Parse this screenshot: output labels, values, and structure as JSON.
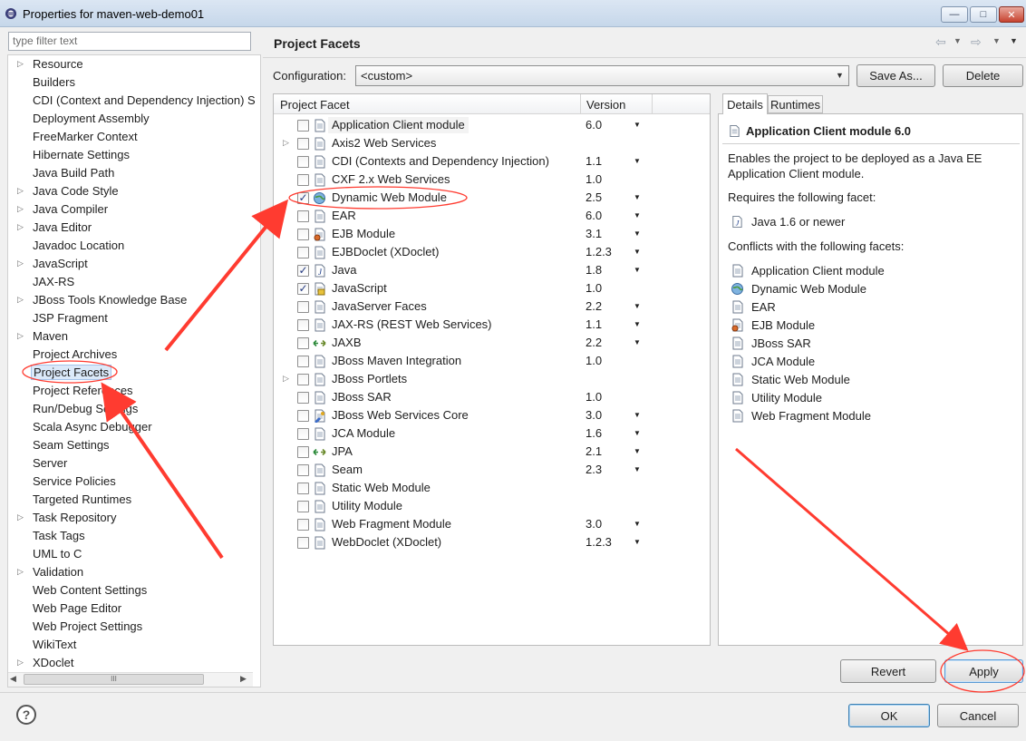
{
  "window": {
    "title": "Properties for maven-web-demo01",
    "minimize_glyph": "—",
    "maximize_glyph": "□",
    "close_glyph": "✕"
  },
  "filter": {
    "placeholder": "type filter text"
  },
  "tree": {
    "items": [
      {
        "label": "Resource",
        "expandable": true
      },
      {
        "label": "Builders",
        "expandable": false
      },
      {
        "label": "CDI (Context and Dependency Injection) S",
        "expandable": false
      },
      {
        "label": "Deployment Assembly",
        "expandable": false
      },
      {
        "label": "FreeMarker Context",
        "expandable": false
      },
      {
        "label": "Hibernate Settings",
        "expandable": false
      },
      {
        "label": "Java Build Path",
        "expandable": false
      },
      {
        "label": "Java Code Style",
        "expandable": true
      },
      {
        "label": "Java Compiler",
        "expandable": true
      },
      {
        "label": "Java Editor",
        "expandable": true
      },
      {
        "label": "Javadoc Location",
        "expandable": false
      },
      {
        "label": "JavaScript",
        "expandable": true
      },
      {
        "label": "JAX-RS",
        "expandable": false
      },
      {
        "label": "JBoss Tools Knowledge Base",
        "expandable": true
      },
      {
        "label": "JSP Fragment",
        "expandable": false
      },
      {
        "label": "Maven",
        "expandable": true
      },
      {
        "label": "Project Archives",
        "expandable": false
      },
      {
        "label": "Project Facets",
        "expandable": false,
        "selected": true
      },
      {
        "label": "Project References",
        "expandable": false
      },
      {
        "label": "Run/Debug Settings",
        "expandable": false
      },
      {
        "label": "Scala Async Debugger",
        "expandable": false
      },
      {
        "label": "Seam Settings",
        "expandable": false
      },
      {
        "label": "Server",
        "expandable": false
      },
      {
        "label": "Service Policies",
        "expandable": false
      },
      {
        "label": "Targeted Runtimes",
        "expandable": false
      },
      {
        "label": "Task Repository",
        "expandable": true
      },
      {
        "label": "Task Tags",
        "expandable": false
      },
      {
        "label": "UML to C",
        "expandable": false
      },
      {
        "label": "Validation",
        "expandable": true
      },
      {
        "label": "Web Content Settings",
        "expandable": false
      },
      {
        "label": "Web Page Editor",
        "expandable": false
      },
      {
        "label": "Web Project Settings",
        "expandable": false
      },
      {
        "label": "WikiText",
        "expandable": false
      },
      {
        "label": "XDoclet",
        "expandable": true
      }
    ],
    "hscroll_thumb": "III",
    "arrow_left": "◀",
    "arrow_right": "▶"
  },
  "header": {
    "title": "Project Facets",
    "nav_back": "⇦",
    "nav_forward": "⇨",
    "dropdown_glyph": "▼"
  },
  "configuration": {
    "label": "Configuration:",
    "value": "<custom>",
    "save_as": "Save As...",
    "delete": "Delete"
  },
  "facets": {
    "col_facet": "Project Facet",
    "col_version": "Version",
    "rows": [
      {
        "name": "Application Client module",
        "version": "6.0",
        "checked": false,
        "dropdown": true,
        "expander": false,
        "icon": "page"
      },
      {
        "name": "Axis2 Web Services",
        "version": "",
        "checked": false,
        "dropdown": false,
        "expander": true,
        "icon": "page"
      },
      {
        "name": "CDI (Contexts and Dependency Injection)",
        "version": "1.1",
        "checked": false,
        "dropdown": true,
        "expander": false,
        "icon": "page"
      },
      {
        "name": "CXF 2.x Web Services",
        "version": "1.0",
        "checked": false,
        "dropdown": false,
        "expander": false,
        "icon": "page"
      },
      {
        "name": "Dynamic Web Module",
        "version": "2.5",
        "checked": true,
        "dropdown": true,
        "expander": false,
        "icon": "globe"
      },
      {
        "name": "EAR",
        "version": "6.0",
        "checked": false,
        "dropdown": true,
        "expander": false,
        "icon": "page"
      },
      {
        "name": "EJB Module",
        "version": "3.1",
        "checked": false,
        "dropdown": true,
        "expander": false,
        "icon": "bean"
      },
      {
        "name": "EJBDoclet (XDoclet)",
        "version": "1.2.3",
        "checked": false,
        "dropdown": true,
        "expander": false,
        "icon": "page"
      },
      {
        "name": "Java",
        "version": "1.8",
        "checked": true,
        "dropdown": true,
        "expander": false,
        "icon": "java"
      },
      {
        "name": "JavaScript",
        "version": "1.0",
        "checked": true,
        "dropdown": false,
        "expander": false,
        "icon": "js"
      },
      {
        "name": "JavaServer Faces",
        "version": "2.2",
        "checked": false,
        "dropdown": true,
        "expander": false,
        "icon": "page"
      },
      {
        "name": "JAX-RS (REST Web Services)",
        "version": "1.1",
        "checked": false,
        "dropdown": true,
        "expander": false,
        "icon": "page"
      },
      {
        "name": "JAXB",
        "version": "2.2",
        "checked": false,
        "dropdown": true,
        "expander": false,
        "icon": "arrows"
      },
      {
        "name": "JBoss Maven Integration",
        "version": "1.0",
        "checked": false,
        "dropdown": false,
        "expander": false,
        "icon": "page"
      },
      {
        "name": "JBoss Portlets",
        "version": "",
        "checked": false,
        "dropdown": false,
        "expander": true,
        "icon": "page"
      },
      {
        "name": "JBoss SAR",
        "version": "1.0",
        "checked": false,
        "dropdown": false,
        "expander": false,
        "icon": "page"
      },
      {
        "name": "JBoss Web Services Core",
        "version": "3.0",
        "checked": false,
        "dropdown": true,
        "expander": false,
        "icon": "ws"
      },
      {
        "name": "JCA Module",
        "version": "1.6",
        "checked": false,
        "dropdown": true,
        "expander": false,
        "icon": "page"
      },
      {
        "name": "JPA",
        "version": "2.1",
        "checked": false,
        "dropdown": true,
        "expander": false,
        "icon": "arrows"
      },
      {
        "name": "Seam",
        "version": "2.3",
        "checked": false,
        "dropdown": true,
        "expander": false,
        "icon": "page"
      },
      {
        "name": "Static Web Module",
        "version": "",
        "checked": false,
        "dropdown": false,
        "expander": false,
        "icon": "page"
      },
      {
        "name": "Utility Module",
        "version": "",
        "checked": false,
        "dropdown": false,
        "expander": false,
        "icon": "page"
      },
      {
        "name": "Web Fragment Module",
        "version": "3.0",
        "checked": false,
        "dropdown": true,
        "expander": false,
        "icon": "page"
      },
      {
        "name": "WebDoclet (XDoclet)",
        "version": "1.2.3",
        "checked": false,
        "dropdown": true,
        "expander": false,
        "icon": "page"
      }
    ]
  },
  "details": {
    "tab_details": "Details",
    "tab_runtimes": "Runtimes",
    "title": "Application Client module 6.0",
    "description": "Enables the project to be deployed as a Java EE Application Client module.",
    "requires_label": "Requires the following facet:",
    "requires_item": "Java 1.6 or newer",
    "conflicts_label": "Conflicts with the following facets:",
    "conflicts": [
      {
        "label": "Application Client module",
        "icon": "page"
      },
      {
        "label": "Dynamic Web Module",
        "icon": "globe"
      },
      {
        "label": "EAR",
        "icon": "page"
      },
      {
        "label": "EJB Module",
        "icon": "bean"
      },
      {
        "label": "JBoss SAR",
        "icon": "page"
      },
      {
        "label": "JCA Module",
        "icon": "page"
      },
      {
        "label": "Static Web Module",
        "icon": "page"
      },
      {
        "label": "Utility Module",
        "icon": "page"
      },
      {
        "label": "Web Fragment Module",
        "icon": "page"
      }
    ]
  },
  "buttons": {
    "revert": "Revert",
    "apply": "Apply",
    "ok": "OK",
    "cancel": "Cancel",
    "help": "?"
  },
  "colors": {
    "annotation_red": "#ff3b30",
    "selection_bg": "#dbe9f9",
    "check_color": "#253a80"
  }
}
